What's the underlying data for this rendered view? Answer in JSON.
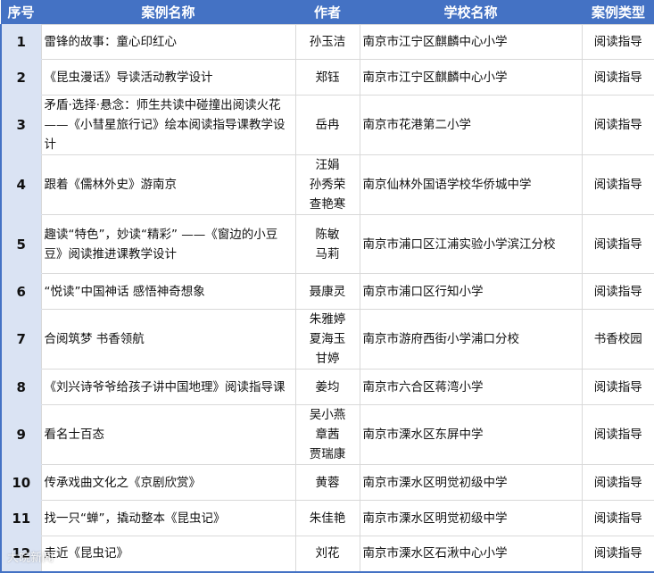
{
  "headers": [
    "序号",
    "案例名称",
    "作者",
    "学校名称",
    "案例类型"
  ],
  "rows": [
    {
      "no": "1",
      "title": "雷锋的故事：童心印红心",
      "authors": [
        "孙玉洁"
      ],
      "school": "南京市江宁区麒麟中心小学",
      "type": "阅读指导"
    },
    {
      "no": "2",
      "title": "《昆虫漫话》导读活动教学设计",
      "authors": [
        "郑钰"
      ],
      "school": "南京市江宁区麒麟中心小学",
      "type": "阅读指导"
    },
    {
      "no": "3",
      "title": "矛盾·选择·悬念：师生共读中碰撞出阅读火花——《小彗星旅行记》绘本阅读指导课教学设计",
      "authors": [
        "岳冉"
      ],
      "school": "南京市花港第二小学",
      "type": "阅读指导"
    },
    {
      "no": "4",
      "title": "跟着《儒林外史》游南京",
      "authors": [
        "汪娟",
        "孙秀荣",
        "查艳寒"
      ],
      "school": "南京仙林外国语学校华侨城中学",
      "type": "阅读指导"
    },
    {
      "no": "5",
      "title": "趣读“特色”，妙读“精彩” ——《窗边的小豆豆》阅读推进课教学设计",
      "authors": [
        "陈敏",
        "马莉"
      ],
      "school": "南京市浦口区江浦实验小学滨江分校",
      "type": "阅读指导"
    },
    {
      "no": "6",
      "title": "“悦读”中国神话 感悟神奇想象",
      "authors": [
        "聂康灵"
      ],
      "school": "南京市浦口区行知小学",
      "type": "阅读指导"
    },
    {
      "no": "7",
      "title": "合阅筑梦 书香领航",
      "authors": [
        "朱雅婷",
        "夏海玉",
        "甘婷"
      ],
      "school": "南京市游府西街小学浦口分校",
      "type": "书香校园"
    },
    {
      "no": "8",
      "title": "《刘兴诗爷爷给孩子讲中国地理》阅读指导课",
      "authors": [
        "姜均"
      ],
      "school": "南京市六合区蒋湾小学",
      "type": "阅读指导"
    },
    {
      "no": "9",
      "title": "看名士百态",
      "authors": [
        "吴小燕",
        "章茜",
        "贾瑞康"
      ],
      "school": "南京市溧水区东屏中学",
      "type": "阅读指导"
    },
    {
      "no": "10",
      "title": "传承戏曲文化之《京剧欣赏》",
      "authors": [
        "黄蓉"
      ],
      "school": "南京市溧水区明觉初级中学",
      "type": "阅读指导"
    },
    {
      "no": "11",
      "title": "找一只“蝉”，撬动整本《昆虫记》",
      "authors": [
        "朱佳艳"
      ],
      "school": "南京市溧水区明觉初级中学",
      "type": "阅读指导"
    },
    {
      "no": "12",
      "title": "走近《昆虫记》",
      "authors": [
        "刘花"
      ],
      "school": "南京市溧水区石湫中心小学",
      "type": "阅读指导"
    }
  ],
  "watermark": "大皖新闻",
  "colors": {
    "header": "#4472c4",
    "index_bg": "#dae3f3"
  }
}
